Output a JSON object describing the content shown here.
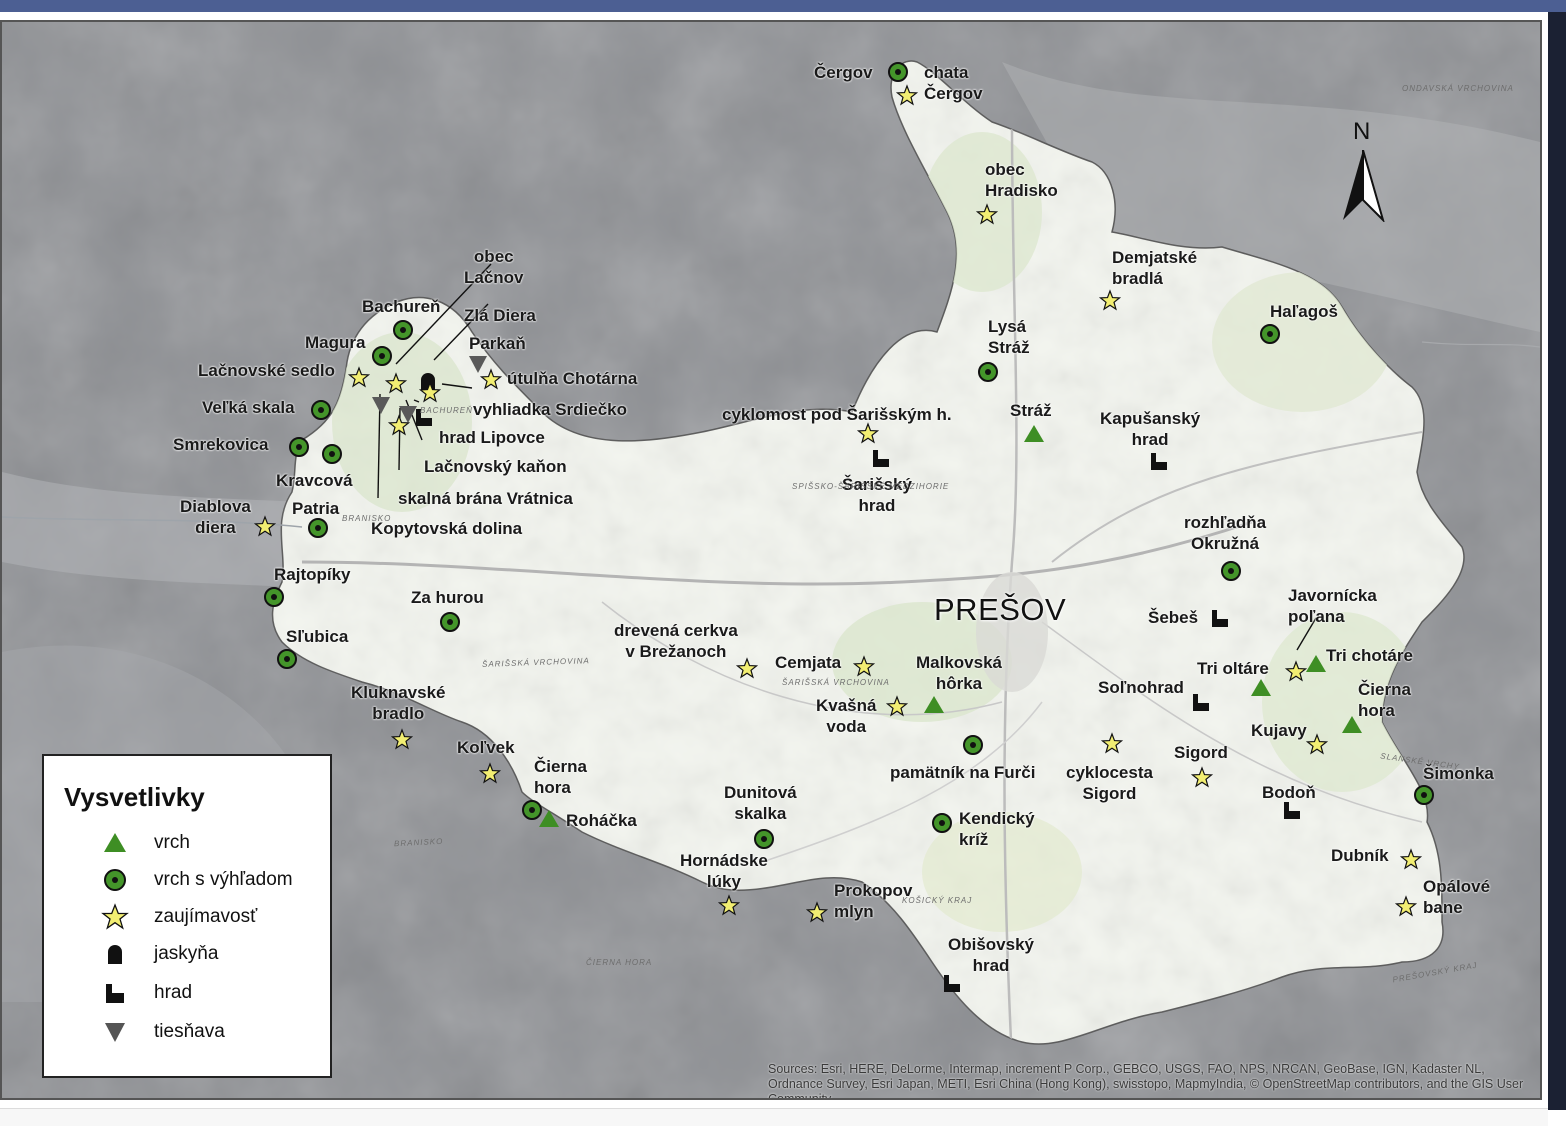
{
  "city": {
    "name": "PREŠOV"
  },
  "north_arrow": {
    "label": "N"
  },
  "legend": {
    "title": "Vysvetlivky",
    "items": [
      {
        "symbol": "triangle-green",
        "label": "vrch"
      },
      {
        "symbol": "circle-dot-green",
        "label": "vrch s výhľadom"
      },
      {
        "symbol": "star-yellow",
        "label": "zaujímavosť"
      },
      {
        "symbol": "cave-black",
        "label": "jaskyňa"
      },
      {
        "symbol": "castle-black",
        "label": "hrad"
      },
      {
        "symbol": "triangle-down-gray",
        "label": "tiesňava"
      }
    ]
  },
  "places": [
    {
      "label": "Čergov",
      "type": "vrch s výhľadom"
    },
    {
      "label": "chata\nČergov",
      "type": "zaujímavosť"
    },
    {
      "label": "obec\nHradisko",
      "type": "zaujímavosť"
    },
    {
      "label": "Demjatské\nbradlá",
      "type": "zaujímavosť"
    },
    {
      "label": "Haľagoš",
      "type": "vrch s výhľadom"
    },
    {
      "label": "Lysá\nStráž",
      "type": "vrch s výhľadom"
    },
    {
      "label": "Stráž",
      "type": "vrch"
    },
    {
      "label": "Kapušanský\nhrad",
      "type": "hrad"
    },
    {
      "label": "cyklomost pod Šarišským h.",
      "type": "zaujímavosť"
    },
    {
      "label": "Šarišský\nhrad",
      "type": "hrad"
    },
    {
      "label": "rozhľadňa\nOkružná",
      "type": "vrch s výhľadom"
    },
    {
      "label": "Šebeš",
      "type": "hrad"
    },
    {
      "label": "Javornícka\npoľana",
      "type": "zaujímavosť"
    },
    {
      "label": "Tri oltáre",
      "type": "vrch"
    },
    {
      "label": "Tri chotáre",
      "type": "vrch"
    },
    {
      "label": "Soľnohrad",
      "type": "hrad"
    },
    {
      "label": "Čierna\nhora",
      "type": "vrch"
    },
    {
      "label": "Kujavy",
      "type": "zaujímavosť"
    },
    {
      "label": "Sigord",
      "type": "zaujímavosť"
    },
    {
      "label": "cyklocesta\nSigord",
      "type": "zaujímavosť"
    },
    {
      "label": "Šimonka",
      "type": "vrch s výhľadom"
    },
    {
      "label": "Bodoň",
      "type": "hrad"
    },
    {
      "label": "Dubník",
      "type": "zaujímavosť"
    },
    {
      "label": "Opálové\nbane",
      "type": "zaujímavosť"
    },
    {
      "label": "obec\nLačnov",
      "type": "zaujímavosť"
    },
    {
      "label": "Bachureň",
      "type": "vrch s výhľadom"
    },
    {
      "label": "Zlá Diera",
      "type": "jaskyňa"
    },
    {
      "label": "Magura",
      "type": "vrch s výhľadom"
    },
    {
      "label": "Parkaň",
      "type": "tiesňava"
    },
    {
      "label": "Lačnovské sedlo",
      "type": "zaujímavosť"
    },
    {
      "label": "útulňa Chotárna",
      "type": "zaujímavosť"
    },
    {
      "label": "Veľká skala",
      "type": "vrch s výhľadom"
    },
    {
      "label": "vyhliadka Srdiečko",
      "type": "zaujímavosť"
    },
    {
      "label": "hrad Lipovce",
      "type": "hrad"
    },
    {
      "label": "Smrekovica",
      "type": "vrch s výhľadom"
    },
    {
      "label": "Lačnovský kaňon",
      "type": "tiesňava"
    },
    {
      "label": "Kravcová",
      "type": "vrch s výhľadom"
    },
    {
      "label": "skalná brána Vrátnica",
      "type": "zaujímavosť"
    },
    {
      "label": "Diablova\ndiera",
      "type": "zaujímavosť"
    },
    {
      "label": "Patria",
      "type": "vrch s výhľadom"
    },
    {
      "label": "Kopytovská dolina",
      "type": "tiesňava"
    },
    {
      "label": "Rajtopíky",
      "type": "vrch s výhľadom"
    },
    {
      "label": "Za hurou",
      "type": "vrch s výhľadom"
    },
    {
      "label": "Sľubica",
      "type": "vrch s výhľadom"
    },
    {
      "label": "drevená cerkva\nv Brežanoch",
      "type": "zaujímavosť"
    },
    {
      "label": "Cemjata",
      "type": "zaujímavosť"
    },
    {
      "label": "Malkovská\nhôrka",
      "type": "vrch"
    },
    {
      "label": "Kvašná\nvoda",
      "type": "zaujímavosť"
    },
    {
      "label": "Kluknavské\nbradlo",
      "type": "zaujímavosť"
    },
    {
      "label": "pamätník na Furči",
      "type": "vrch s výhľadom"
    },
    {
      "label": "Koľvek",
      "type": "zaujímavosť"
    },
    {
      "label": "Čierna\nhora",
      "type": "vrch s výhľadom"
    },
    {
      "label": "Roháčka",
      "type": "vrch"
    },
    {
      "label": "Dunitová\nskalka",
      "type": "vrch s výhľadom"
    },
    {
      "label": "Kendický\nkríž",
      "type": "vrch s výhľadom"
    },
    {
      "label": "Hornádske\nlúky",
      "type": "zaujímavosť"
    },
    {
      "label": "Prokopov\nmlyn",
      "type": "zaujímavosť"
    },
    {
      "label": "Obišovský\nhrad",
      "type": "hrad"
    }
  ],
  "basemap_labels": [
    "ONDAVSKÁ VRCHOVINA",
    "BACHUREŇ",
    "BRANISKO",
    "ŠARIŠSKÁ VRCHOVINA",
    "ČIERNA HORA",
    "SLANSKÉ VRCHY",
    "SPIŠSKO-ŠARIŠSKÉ MEDZIHORIE",
    "KOŠICKÝ KRAJ",
    "PREŠOVSKÝ KRAJ"
  ],
  "attribution": "Sources: Esri, HERE, DeLorme, Intermap, increment P Corp., GEBCO, USGS, FAO, NPS, NRCAN, GeoBase, IGN, Kadaster NL, Ordnance Survey, Esri Japan, METI, Esri China (Hong Kong), swisstopo, MapmyIndia, © OpenStreetMap contributors, and the GIS User Community"
}
